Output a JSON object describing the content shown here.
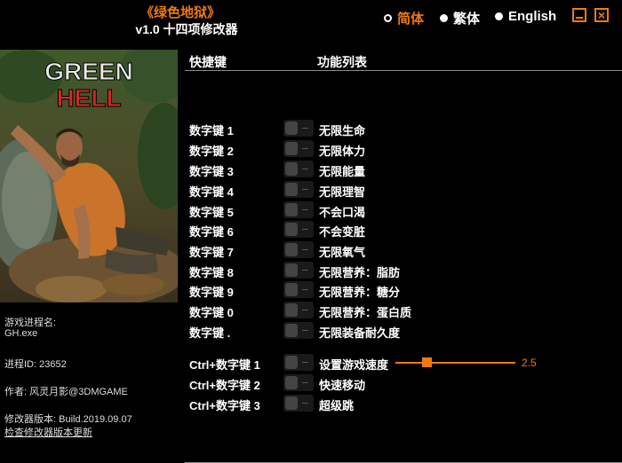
{
  "header": {
    "title": "《绿色地狱》",
    "subtitle": "v1.0 十四项修改器"
  },
  "languages": [
    {
      "label": "简体",
      "selected": true
    },
    {
      "label": "繁体",
      "selected": false
    },
    {
      "label": "English",
      "selected": false
    }
  ],
  "cover": {
    "logo_line1": "GREEN",
    "logo_line2": "HELL"
  },
  "info": {
    "process_name_label": "游戏进程名:",
    "process_name": "GH.exe",
    "process_id": "进程ID:  23652",
    "author": "作者:  风灵月影@3DMGAME",
    "version": "修改器版本:  Build.2019.09.07",
    "update_link": "检查修改器版本更新"
  },
  "table": {
    "col_hotkey": "快捷键",
    "col_function": "功能列表"
  },
  "cheats": [
    {
      "hotkey": "数字键 1",
      "label": "无限生命"
    },
    {
      "hotkey": "数字键 2",
      "label": "无限体力"
    },
    {
      "hotkey": "数字键 3",
      "label": "无限能量"
    },
    {
      "hotkey": "数字键 4",
      "label": "无限理智"
    },
    {
      "hotkey": "数字键 5",
      "label": "不会口渴"
    },
    {
      "hotkey": "数字键 6",
      "label": "不会变脏"
    },
    {
      "hotkey": "数字键 7",
      "label": "无限氧气"
    },
    {
      "hotkey": "数字键 8",
      "label": "无限营养：脂肪"
    },
    {
      "hotkey": "数字键 9",
      "label": "无限营养：糖分"
    },
    {
      "hotkey": "数字键 0",
      "label": "无限营养：蛋白质"
    },
    {
      "hotkey": "数字键 .",
      "label": "无限装备耐久度"
    },
    {
      "hotkey": "Ctrl+数字键 1",
      "label": "设置游戏速度"
    },
    {
      "hotkey": "Ctrl+数字键 2",
      "label": "快速移动"
    },
    {
      "hotkey": "Ctrl+数字键 3",
      "label": "超级跳"
    }
  ],
  "speed": {
    "value": "2.5"
  },
  "colors": {
    "accent": "#f07a10",
    "logo_green": "#e8e8e8",
    "logo_red": "#d8262a"
  },
  "icons": {
    "minimize": "minimize-icon",
    "close": "close-icon"
  }
}
